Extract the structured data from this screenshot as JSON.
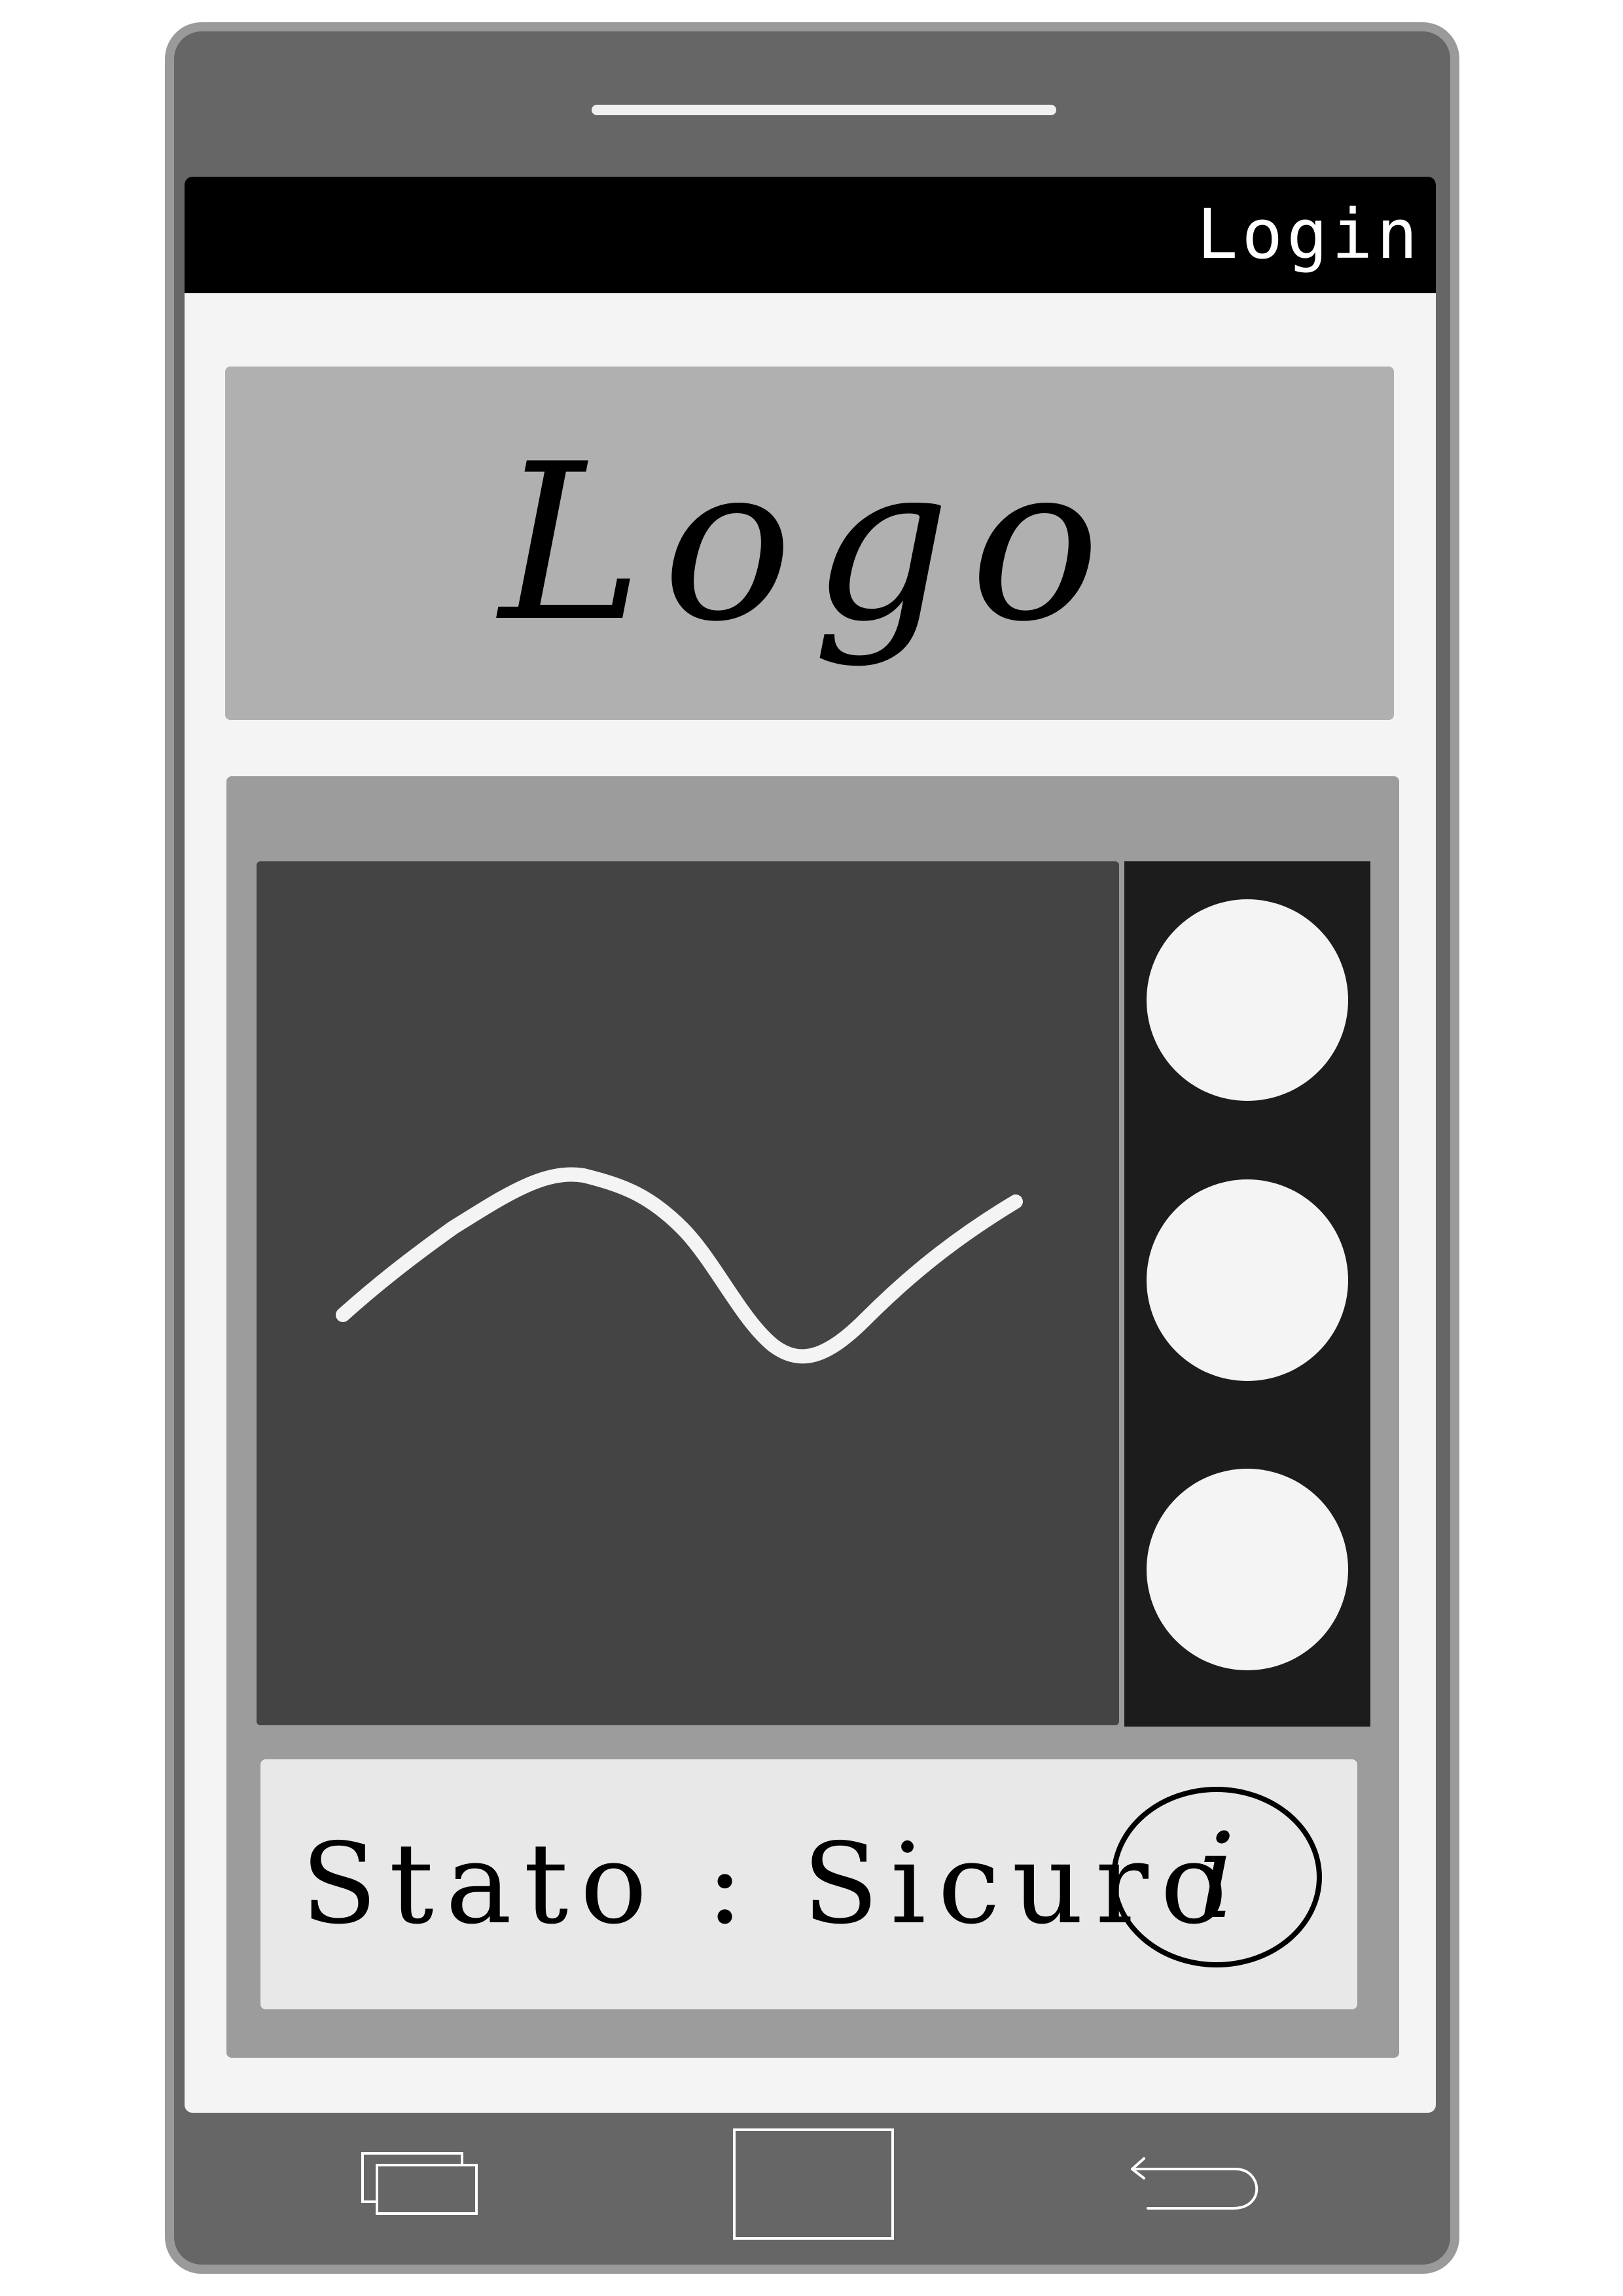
{
  "app": {
    "topbar": {
      "login_label": "Login"
    },
    "logo_banner": {
      "text": "Logo"
    },
    "status": {
      "text": "Stato : Sicuro",
      "info_glyph": "i"
    },
    "colors": {
      "phone_frame": "#666666",
      "screen_bg": "#f4f4f4",
      "topbar_bg": "#000000",
      "logo_bg": "#b0b0b0",
      "panel_bg": "#9c9c9c",
      "graph_bg": "#444444",
      "sidebar_bg": "#1c1c1c",
      "status_bg": "#e8e8e8"
    },
    "sidebar": {
      "buttons": [
        {
          "icon": "circle-icon"
        },
        {
          "icon": "circle-icon"
        },
        {
          "icon": "circle-icon"
        }
      ]
    },
    "navbar": {
      "items": [
        {
          "icon": "recent-apps-icon"
        },
        {
          "icon": "home-icon"
        },
        {
          "icon": "back-icon"
        }
      ]
    }
  }
}
